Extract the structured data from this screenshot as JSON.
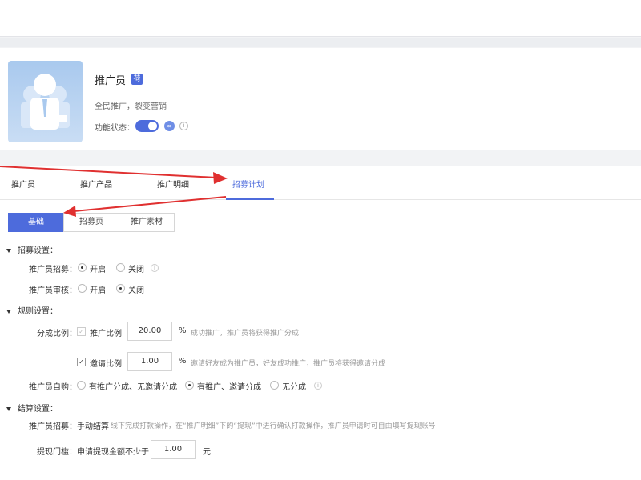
{
  "app": {
    "title": "推广员",
    "badge": "荷",
    "subtitle": "全民推广，裂变营销",
    "status_label": "功能状态：",
    "status_on": true
  },
  "tabs": [
    {
      "label": "推广员",
      "active": false
    },
    {
      "label": "推广产品",
      "active": false
    },
    {
      "label": "推广明细",
      "active": false
    },
    {
      "label": "招募计划",
      "active": true
    }
  ],
  "subtabs": [
    {
      "label": "基础",
      "active": true
    },
    {
      "label": "招募页",
      "active": false
    },
    {
      "label": "推广素材",
      "active": false
    }
  ],
  "recruit": {
    "section": "招募设置：",
    "recruit_label": "推广员招募：",
    "review_label": "推广员审核：",
    "open": "开启",
    "close": "关闭",
    "recruit_value": "开启",
    "review_value": "关闭"
  },
  "rules": {
    "section": "规则设置：",
    "ratio_label": "分成比例：",
    "promo_ratio_label": "推广比例",
    "promo_ratio_value": "20.00",
    "promo_hint": "成功推广，推广员将获得推广分成",
    "invite_ratio_label": "邀请比例",
    "invite_ratio_value": "1.00",
    "invite_hint": "邀请好友成为推广员，好友成功推广，推广员将获得邀请分成",
    "percent": "%",
    "self_buy_label": "推广员自购：",
    "self_buy_options": [
      "有推广分成、无邀请分成",
      "有推广、邀请分成",
      "无分成"
    ],
    "self_buy_selected": 1
  },
  "settle": {
    "section": "结算设置：",
    "recruit_label": "推广员招募：手动结算",
    "recruit_hint": "线下完成打款操作，在“推广明细”下的“提现”中进行确认打款操作，推广员申请时可自由填写提现账号",
    "threshold_label": "提现门槛：申请提现金额不少于",
    "threshold_value": "1.00",
    "unit": "元"
  },
  "colors": {
    "accent": "#4d6bdc",
    "arrow": "#e03030"
  }
}
